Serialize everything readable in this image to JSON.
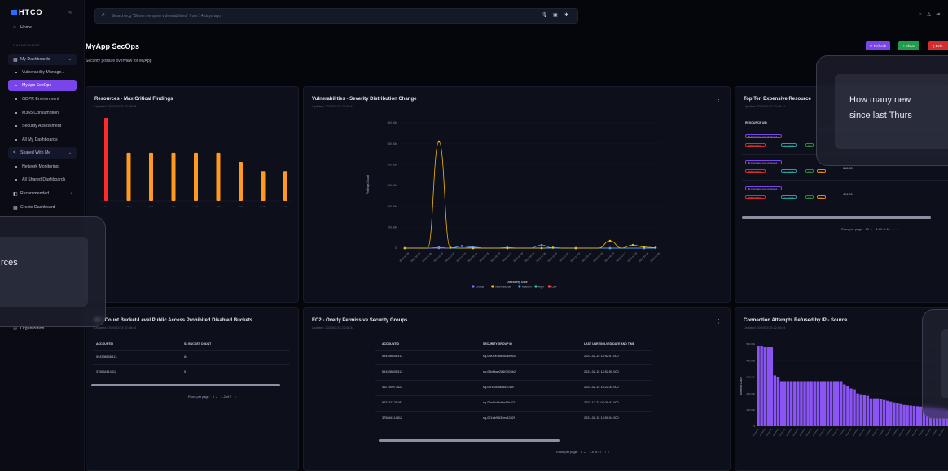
{
  "app": {
    "logo_text": "HTCO",
    "collapse_icon": "chevrons-left-icon"
  },
  "sidebar": {
    "home": "Home",
    "section_label": "DASHBOARDS",
    "my_dashboards": "My Dashboards",
    "items": [
      "Vulnerability Manage...",
      "MyApp SecOps",
      "GDPR Environment",
      "M365 Consumption",
      "Security Assessment",
      "All My Dashboards"
    ],
    "shared_with_me": "Shared With Me",
    "shared_items": [
      "Network Monitoring",
      "All Shared Dashboards"
    ],
    "recommended": "Recommended",
    "create_dashboard": "Create Dashboard",
    "organization": "Organization"
  },
  "search": {
    "placeholder": "Search e.g \"Show me open vulnerabilities\" from 14 days ago"
  },
  "header": {
    "title": "MyApp SecOps",
    "subtitle": "Security posture overview for MyApp",
    "refresh": "Refresh",
    "share": "Share",
    "delete": "Dele"
  },
  "panel1": {
    "title": "Resources - Max Critical Findings",
    "updated": "Updated: 2024/02/15 22:48:08"
  },
  "panel2": {
    "title": "Vulnerabilities - Severity Distribution Change",
    "updated": "Updated: 2024/02/15 22:48:43",
    "ylabel": "Findings Count",
    "xlabel": "Discovery Date",
    "legend": [
      "Critical",
      "Informational",
      "Medium",
      "High",
      "Low"
    ]
  },
  "panel3": {
    "title": "Top Ten Expensive Resource",
    "updated": "Updated: 2024/02/15 22:48:41",
    "col": "RESOURCE UID",
    "rows": [
      {
        "name": "db-htcot-app-core-backend...",
        "id": "3786011490...",
        "region": "us-east-1",
        "cost": ""
      },
      {
        "name": "db-htcot-app-core-backend...",
        "id": "3786011490...",
        "region": "us-east-1",
        "cost": "616.63"
      },
      {
        "name": "db-htcot-app-core-backend...",
        "id": "3786011490...",
        "region": "us-east-1",
        "cost": "474.76"
      }
    ],
    "rds": "rds",
    "aws": "aws",
    "rows_per_page": "Rows per page:",
    "per_page": "10",
    "range": "1-10 of 10"
  },
  "panel4": {
    "title": "S3 - Count Bucket-Level Public Access Prohibited Disabled Buckets",
    "updated": "Updated: 2024/02/15 22:48:44",
    "cols": [
      "ACCOUNTID",
      "S3 BUCKET COUNT"
    ],
    "rows": [
      [
        "594398606313",
        "84"
      ],
      [
        "375664114812",
        "5"
      ]
    ],
    "rows_per_page": "Rows per page:",
    "per_page": "5",
    "range": "1-2 of 2"
  },
  "panel5": {
    "title": "EC2 - Overly Permissive Security Groups",
    "updated": "Updated: 2024/02/15 22:48:34",
    "cols": [
      "ACCOUNTID",
      "SECURITY GROUP ID",
      "LAST UNRESOLVED DATE AND TIME"
    ],
    "rows": [
      [
        "594398606313",
        "sg-03f0ce3dd46cdd964",
        "2024-02-15 18:52:57.000"
      ],
      [
        "594398606313",
        "sg-08b6bae281f0505b2",
        "2024-02-15 18:52:55.000"
      ],
      [
        "462759973522",
        "sg-0cf1640fd455401cf",
        "2024-02-15 18:22:34.000"
      ],
      [
        "923747129181",
        "sg-06ef8c8bdbe45b471",
        "2023-12-22 08:38:43.000"
      ],
      [
        "375664114812",
        "sg-021eb9f635ec4282f",
        "2024-02-15 13:50:04.000"
      ]
    ],
    "rows_per_page": "Rows per page:",
    "per_page": "5",
    "range": "1-5 of 47"
  },
  "panel6": {
    "title": "Connection Attempts Refused by IP - Source",
    "updated": "Updated: 2024/02/15 22:48:44",
    "ylabel": "Refused Count"
  },
  "overlays": {
    "left_text": "rces",
    "right_text_1": "How many new",
    "right_text_2": "since last Thurs"
  },
  "chart_data": [
    {
      "type": "bar",
      "title": "Resources - Max Critical Findings",
      "categories": [
        "i-0a1",
        "i-0b2",
        "i-0c3",
        "i-0d4",
        "i-0e5",
        "i-0f6",
        "i-107",
        "i-118",
        "i-129"
      ],
      "values": [
        100,
        58,
        58,
        58,
        58,
        58,
        47,
        36,
        36
      ],
      "highlight_color": "#ff2a2a",
      "bar_color": "#ff9a1f"
    },
    {
      "type": "line",
      "title": "Vulnerabilities - Severity Distribution Change",
      "yticks": [
        "0",
        "100.00k",
        "200.00k",
        "300.00k",
        "400.00k",
        "500.00k",
        "600.00k"
      ],
      "ylim": [
        0,
        600000
      ],
      "x": [
        "2023-10-09",
        "2023-10-23",
        "2023-11-06",
        "2023-11-20",
        "2023-12-04",
        "2023-12-18",
        "2024-01-01",
        "2024-01-15",
        "2024-01-29",
        "2024-02-12"
      ],
      "series": [
        {
          "name": "Informational",
          "color": "#f5b90f",
          "values": [
            0,
            0,
            0,
            510000,
            2000,
            0,
            0,
            0,
            0,
            0,
            0,
            0,
            0,
            2000,
            0,
            0,
            0,
            0,
            35000,
            0,
            15000,
            5000,
            2000
          ]
        },
        {
          "name": "Medium",
          "color": "#4f9cf5",
          "values": [
            0,
            0,
            0,
            2000,
            0,
            10000,
            5000,
            0,
            0,
            0,
            0,
            0,
            15000,
            0,
            0,
            0,
            0,
            0,
            0,
            0,
            0,
            0,
            0
          ]
        },
        {
          "name": "High",
          "color": "#26c6a4",
          "values": [
            0,
            0,
            0,
            3000,
            0,
            0,
            3000,
            0,
            0,
            3000,
            0,
            0,
            0,
            0,
            0,
            0,
            0,
            0,
            0,
            0,
            0,
            0,
            0
          ]
        },
        {
          "name": "Critical",
          "color": "#8c6cff",
          "values": [
            0,
            0,
            0,
            1000,
            0,
            0,
            0,
            0,
            0,
            0,
            0,
            0,
            0,
            0,
            0,
            0,
            0,
            0,
            0,
            0,
            0,
            0,
            0
          ]
        },
        {
          "name": "Low",
          "color": "#ff4d4d",
          "values": [
            0,
            0,
            0,
            0,
            0,
            0,
            0,
            0,
            0,
            0,
            0,
            0,
            0,
            0,
            0,
            0,
            0,
            0,
            0,
            0,
            0,
            0,
            0
          ]
        }
      ]
    },
    {
      "type": "bar",
      "title": "Connection Attempts Refused by IP - Source",
      "yticks": [
        "0",
        "100.00k",
        "200.00k",
        "300.00k",
        "400.00k",
        "500.00k"
      ],
      "ylim": [
        0,
        500000
      ],
      "values": [
        490000,
        490000,
        485000,
        480000,
        480000,
        310000,
        300000,
        275000,
        275000,
        275000,
        275000,
        275000,
        275000,
        275000,
        275000,
        275000,
        275000,
        275000,
        275000,
        275000,
        275000,
        275000,
        275000,
        275000,
        275000,
        275000,
        255000,
        245000,
        230000,
        225000,
        200000,
        195000,
        190000,
        185000,
        170000,
        170000,
        170000,
        165000,
        160000,
        155000,
        150000,
        145000,
        140000,
        135000,
        130000,
        128000,
        126000,
        124000,
        122000,
        120000,
        118000,
        118000,
        116000,
        114000,
        112000,
        110000,
        108000,
        100000
      ],
      "bar_color": "#8a55f2"
    }
  ]
}
